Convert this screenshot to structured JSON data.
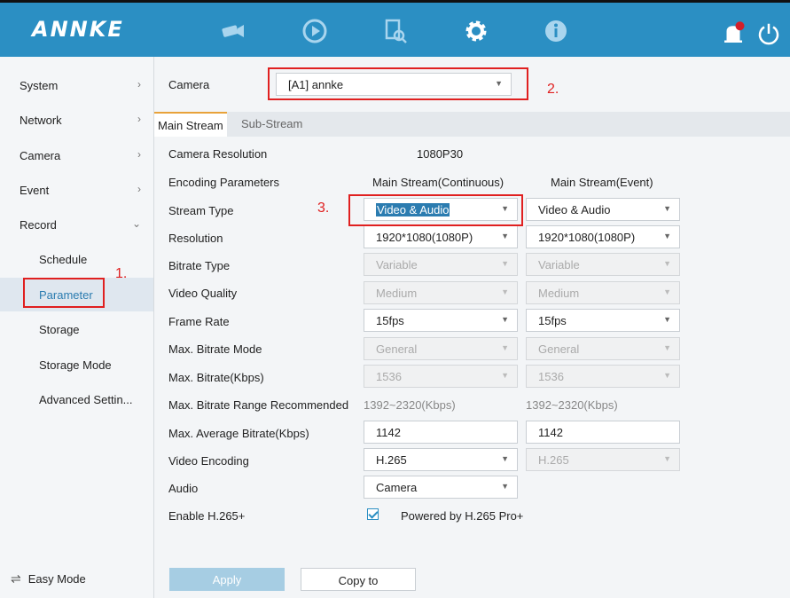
{
  "app": {
    "logo": "ANNKE"
  },
  "topnav": {
    "icons": [
      "camera-icon",
      "playback-icon",
      "search-file-icon",
      "gear-icon",
      "info-icon"
    ],
    "right_icons": [
      "notification-bell-icon",
      "power-icon"
    ]
  },
  "sidebar": {
    "items": [
      {
        "label": "System",
        "chevron": "›"
      },
      {
        "label": "Network",
        "chevron": "›"
      },
      {
        "label": "Camera",
        "chevron": "›"
      },
      {
        "label": "Event",
        "chevron": "›"
      },
      {
        "label": "Record",
        "chevron": "⌄"
      }
    ],
    "sub_items": [
      "Schedule",
      "Parameter",
      "Storage",
      "Storage Mode",
      "Advanced Settin..."
    ],
    "active": "Parameter",
    "easy_mode": "Easy Mode"
  },
  "camera": {
    "label": "Camera",
    "value": "[A1] annke"
  },
  "tabs": [
    "Main Stream",
    "Sub-Stream"
  ],
  "columns": {
    "main": "Main Stream(Continuous)",
    "event": "Main Stream(Event)"
  },
  "camera_resolution": {
    "label": "Camera Resolution",
    "value": "1080P30"
  },
  "encoding_parameters": "Encoding Parameters",
  "rows": {
    "stream_type": {
      "label": "Stream Type",
      "main": "Video & Audio",
      "event": "Video & Audio"
    },
    "resolution": {
      "label": "Resolution",
      "main": "1920*1080(1080P)",
      "event": "1920*1080(1080P)"
    },
    "bitrate_type": {
      "label": "Bitrate Type",
      "main": "Variable",
      "event": "Variable"
    },
    "video_quality": {
      "label": "Video Quality",
      "main": "Medium",
      "event": "Medium"
    },
    "frame_rate": {
      "label": "Frame Rate",
      "main": "15fps",
      "event": "15fps"
    },
    "max_bitrate_mode": {
      "label": "Max. Bitrate Mode",
      "main": "General",
      "event": "General"
    },
    "max_bitrate": {
      "label": "Max. Bitrate(Kbps)",
      "main": "1536",
      "event": "1536"
    },
    "range": {
      "label": "Max. Bitrate Range Recommended",
      "main": "1392~2320(Kbps)",
      "event": "1392~2320(Kbps)"
    },
    "avg_bitrate": {
      "label": "Max. Average Bitrate(Kbps)",
      "main": "1142",
      "event": "1142"
    },
    "video_encoding": {
      "label": "Video Encoding",
      "main": "H.265",
      "event": "H.265"
    },
    "audio": {
      "label": "Audio",
      "main": "Camera"
    },
    "h265plus": {
      "label": "Enable H.265+",
      "text": "Powered by H.265 Pro+"
    }
  },
  "buttons": {
    "apply": "Apply",
    "copy": "Copy to"
  },
  "annotations": [
    "1.",
    "2.",
    "3."
  ],
  "colors": {
    "topbar": "#2b8fc3",
    "annotation": "#e02020",
    "active_tab": "#e8a23a"
  }
}
